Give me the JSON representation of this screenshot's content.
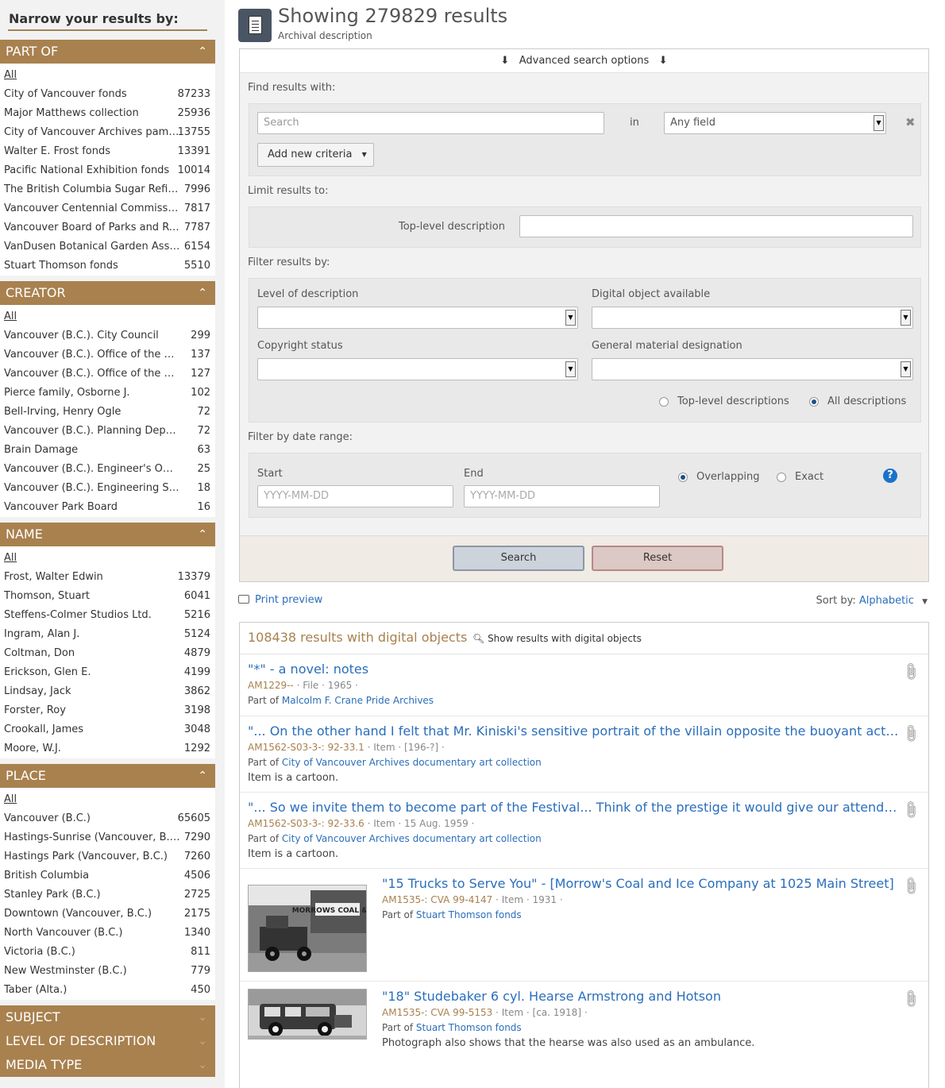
{
  "sidebar": {
    "title": "Narrow your results by:",
    "facets": [
      {
        "name": "PART OF",
        "all_label": "All",
        "items": [
          {
            "label": "City of Vancouver fonds",
            "count": "87233"
          },
          {
            "label": "Major Matthews collection",
            "count": "25936"
          },
          {
            "label": "City of Vancouver Archives pamphl",
            "count": "13755"
          },
          {
            "label": "Walter E. Frost fonds",
            "count": "13391"
          },
          {
            "label": "Pacific National Exhibition fonds",
            "count": "10014"
          },
          {
            "label": "The British Columbia Sugar Refinin…",
            "count": "7996"
          },
          {
            "label": "Vancouver Centennial Commission…",
            "count": "7817"
          },
          {
            "label": "Vancouver Board of Parks and Recr…",
            "count": "7787"
          },
          {
            "label": "VanDusen Botanical Garden Associ…",
            "count": "6154"
          },
          {
            "label": "Stuart Thomson fonds",
            "count": "5510"
          }
        ]
      },
      {
        "name": "CREATOR",
        "all_label": "All",
        "items": [
          {
            "label": "Vancouver (B.C.). City Council",
            "count": "299"
          },
          {
            "label": "Vancouver (B.C.). Office of the City…",
            "count": "137"
          },
          {
            "label": "Vancouver (B.C.). Office of the City…",
            "count": "127"
          },
          {
            "label": "Pierce family, Osborne J.",
            "count": "102"
          },
          {
            "label": "Bell-Irving, Henry Ogle",
            "count": "72"
          },
          {
            "label": "Vancouver (B.C.). Planning Depart…",
            "count": "72"
          },
          {
            "label": "Brain Damage",
            "count": "63"
          },
          {
            "label": "Vancouver (B.C.). Engineer's Office",
            "count": "25"
          },
          {
            "label": "Vancouver (B.C.). Engineering Servi…",
            "count": "18"
          },
          {
            "label": "Vancouver Park Board",
            "count": "16"
          }
        ]
      },
      {
        "name": "NAME",
        "all_label": "All",
        "items": [
          {
            "label": "Frost, Walter Edwin",
            "count": "13379"
          },
          {
            "label": "Thomson, Stuart",
            "count": "6041"
          },
          {
            "label": "Steffens-Colmer Studios Ltd.",
            "count": "5216"
          },
          {
            "label": "Ingram, Alan J.",
            "count": "5124"
          },
          {
            "label": "Coltman, Don",
            "count": "4879"
          },
          {
            "label": "Erickson, Glen E.",
            "count": "4199"
          },
          {
            "label": "Lindsay, Jack",
            "count": "3862"
          },
          {
            "label": "Forster, Roy",
            "count": "3198"
          },
          {
            "label": "Crookall, James",
            "count": "3048"
          },
          {
            "label": "Moore, W.J.",
            "count": "1292"
          }
        ]
      },
      {
        "name": "PLACE",
        "all_label": "All",
        "items": [
          {
            "label": "Vancouver (B.C.)",
            "count": "65605"
          },
          {
            "label": "Hastings-Sunrise (Vancouver, B.C.)",
            "count": "7290"
          },
          {
            "label": "Hastings Park (Vancouver, B.C.)",
            "count": "7260"
          },
          {
            "label": "British Columbia",
            "count": "4506"
          },
          {
            "label": "Stanley Park (B.C.)",
            "count": "2725"
          },
          {
            "label": "Downtown (Vancouver, B.C.)",
            "count": "2175"
          },
          {
            "label": "North Vancouver (B.C.)",
            "count": "1340"
          },
          {
            "label": "Victoria (B.C.)",
            "count": "811"
          },
          {
            "label": "New Westminster (B.C.)",
            "count": "779"
          },
          {
            "label": "Taber (Alta.)",
            "count": "450"
          }
        ]
      }
    ],
    "collapsed_facets": [
      "SUBJECT",
      "LEVEL OF DESCRIPTION",
      "MEDIA TYPE"
    ]
  },
  "header": {
    "title": "Showing 279829 results",
    "subtitle": "Archival description"
  },
  "advanced": {
    "toggle_label": "Advanced search options",
    "find_label": "Find results with:",
    "search_placeholder": "Search",
    "in_label": "in",
    "field_select": "Any field",
    "add_criteria": "Add new criteria",
    "limit_label": "Limit results to:",
    "top_level_label": "Top-level description",
    "filter_label": "Filter results by:",
    "level_label": "Level of description",
    "digital_label": "Digital object available",
    "copyright_label": "Copyright status",
    "gmd_label": "General material designation",
    "radio_top": "Top-level descriptions",
    "radio_all": "All descriptions",
    "date_label": "Filter by date range:",
    "start_label": "Start",
    "end_label": "End",
    "start_placeholder": "YYYY-MM-DD",
    "end_placeholder": "YYYY-MM-DD",
    "radio_overlapping": "Overlapping",
    "radio_exact": "Exact",
    "search_button": "Search",
    "reset_button": "Reset"
  },
  "toolbar": {
    "print_preview": "Print preview",
    "sort_label": "Sort by:",
    "sort_value": "Alphabetic"
  },
  "results": {
    "count_text": "108438 results with digital objects",
    "show_digital": "Show results with digital objects",
    "part_of_prefix": "Part of",
    "items": [
      {
        "title": "\"*\" - a novel: notes",
        "ref": "AM1229--",
        "level": "File",
        "date": "1965",
        "part_of": "Malcolm F. Crane Pride Archives",
        "note": ""
      },
      {
        "title": "\"... On the other hand I felt that Mr. Kiniski's sensitive portrait of the villain opposite the buoyant actin…",
        "ref": "AM1562-S03-3-: 92-33.1",
        "level": "Item",
        "date": "[196-?]",
        "part_of": "City of Vancouver Archives documentary art collection",
        "note": "Item is a cartoon."
      },
      {
        "title": "\"... So we invite them to become part of the Festival... Think of the prestige it would give our attendan…",
        "ref": "AM1562-S03-3-: 92-33.6",
        "level": "Item",
        "date": "15 Aug. 1959",
        "part_of": "City of Vancouver Archives documentary art collection",
        "note": "Item is a cartoon."
      },
      {
        "title": "\"15 Trucks to Serve You\" - [Morrow's Coal and Ice Company at 1025 Main Street]",
        "ref": "AM1535-: CVA 99-4147",
        "level": "Item",
        "date": "1931",
        "part_of": "Stuart Thomson fonds",
        "note": "",
        "thumb_text": "MORROWS COAL & ICE"
      },
      {
        "title": "\"18\" Studebaker 6 cyl. Hearse Armstrong and Hotson",
        "ref": "AM1535-: CVA 99-5153",
        "level": "Item",
        "date": "[ca. 1918]",
        "part_of": "Stuart Thomson fonds",
        "note": "Photograph also shows that the hearse was also used as an ambulance."
      }
    ]
  }
}
